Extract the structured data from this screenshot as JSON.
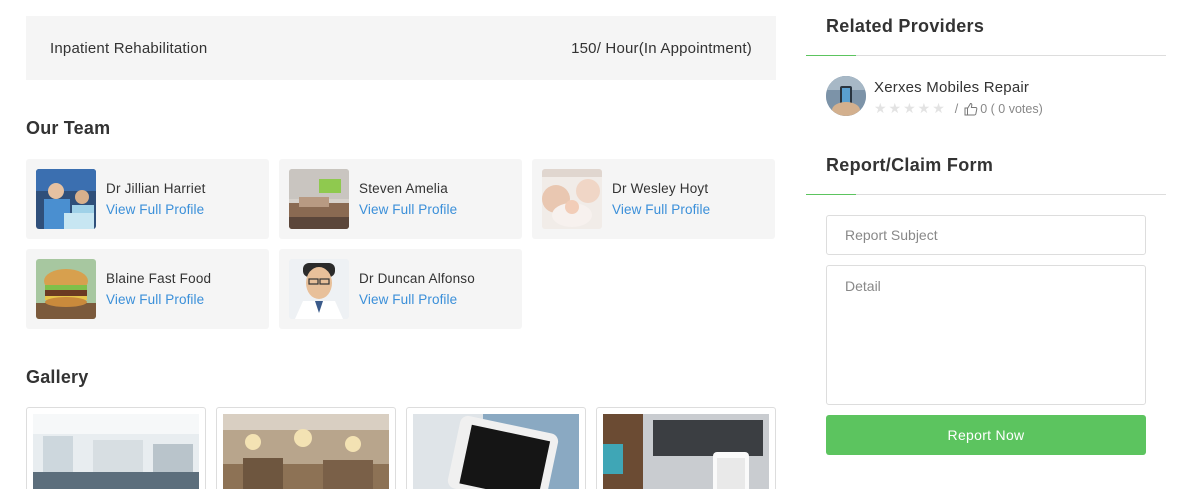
{
  "service": {
    "name": "Inpatient Rehabilitation",
    "price": "150/ Hour(In Appointment)"
  },
  "team": {
    "title": "Our Team",
    "members": [
      {
        "name": "Dr Jillian Harriet",
        "link": "View Full Profile"
      },
      {
        "name": "Steven Amelia",
        "link": "View Full Profile"
      },
      {
        "name": "Dr Wesley Hoyt",
        "link": "View Full Profile"
      },
      {
        "name": "Blaine Fast Food",
        "link": "View Full Profile"
      },
      {
        "name": "Dr Duncan Alfonso",
        "link": "View Full Profile"
      }
    ]
  },
  "gallery": {
    "title": "Gallery"
  },
  "related": {
    "title": "Related Providers",
    "provider": {
      "name": "Xerxes Mobiles Repair",
      "separator": "/",
      "votes": "0 ( 0 votes)"
    }
  },
  "report": {
    "title": "Report/Claim Form",
    "subject_placeholder": "Report Subject",
    "detail_placeholder": "Detail",
    "submit_label": "Report Now"
  },
  "colors": {
    "accent": "#5cc45f",
    "link": "#3a8fd9",
    "card_bg": "#f5f5f5"
  }
}
